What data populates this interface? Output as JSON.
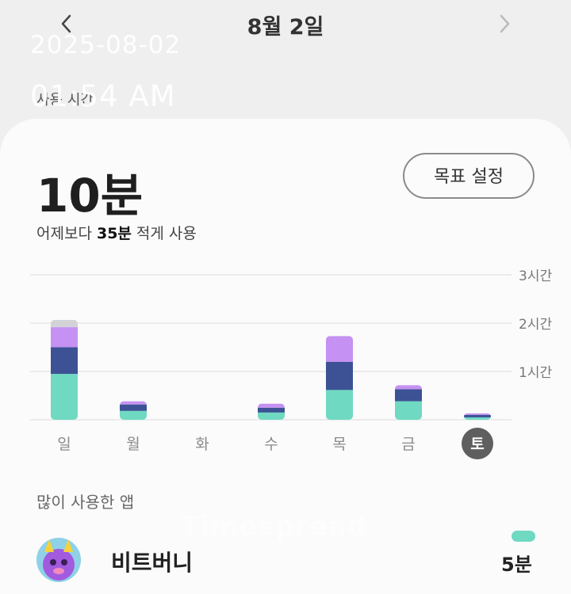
{
  "header": {
    "title": "8월 2일",
    "prev_icon": "chevron-left-icon",
    "next_icon": "chevron-right-icon"
  },
  "overlay": {
    "date": "2025-08-02",
    "time": "01:54 AM",
    "brand": "Timespread"
  },
  "section": {
    "label": "사용 시간"
  },
  "summary": {
    "total": "10분",
    "compare_prefix": "어제보다 ",
    "compare_value": "35분",
    "compare_suffix": " 적게 사용",
    "goal_button": "목표 설정"
  },
  "chart_data": {
    "type": "bar",
    "stacked": true,
    "categories": [
      "일",
      "월",
      "화",
      "수",
      "목",
      "금",
      "토"
    ],
    "selected_category": "토",
    "ytick_labels": [
      "1시간",
      "2시간",
      "3시간"
    ],
    "ylim_minutes": [
      0,
      180
    ],
    "grid": true,
    "series": [
      {
        "values": [
          57,
          11,
          0,
          9,
          37,
          23,
          3
        ],
        "color": "#6fd9c2"
      },
      {
        "values": [
          33,
          8,
          0,
          6,
          35,
          15,
          3
        ],
        "color": "#3c5294"
      },
      {
        "values": [
          25,
          4,
          0,
          5,
          32,
          5,
          2
        ],
        "color": "#c591f2"
      },
      {
        "values": [
          9,
          0,
          0,
          0,
          0,
          0,
          0
        ],
        "color": "#d3d3d7"
      }
    ]
  },
  "apps": {
    "label": "많이 사용한 앱",
    "items": [
      {
        "name": "비트버니",
        "time": "5분",
        "icon": "bitbunny-app-icon"
      }
    ]
  }
}
